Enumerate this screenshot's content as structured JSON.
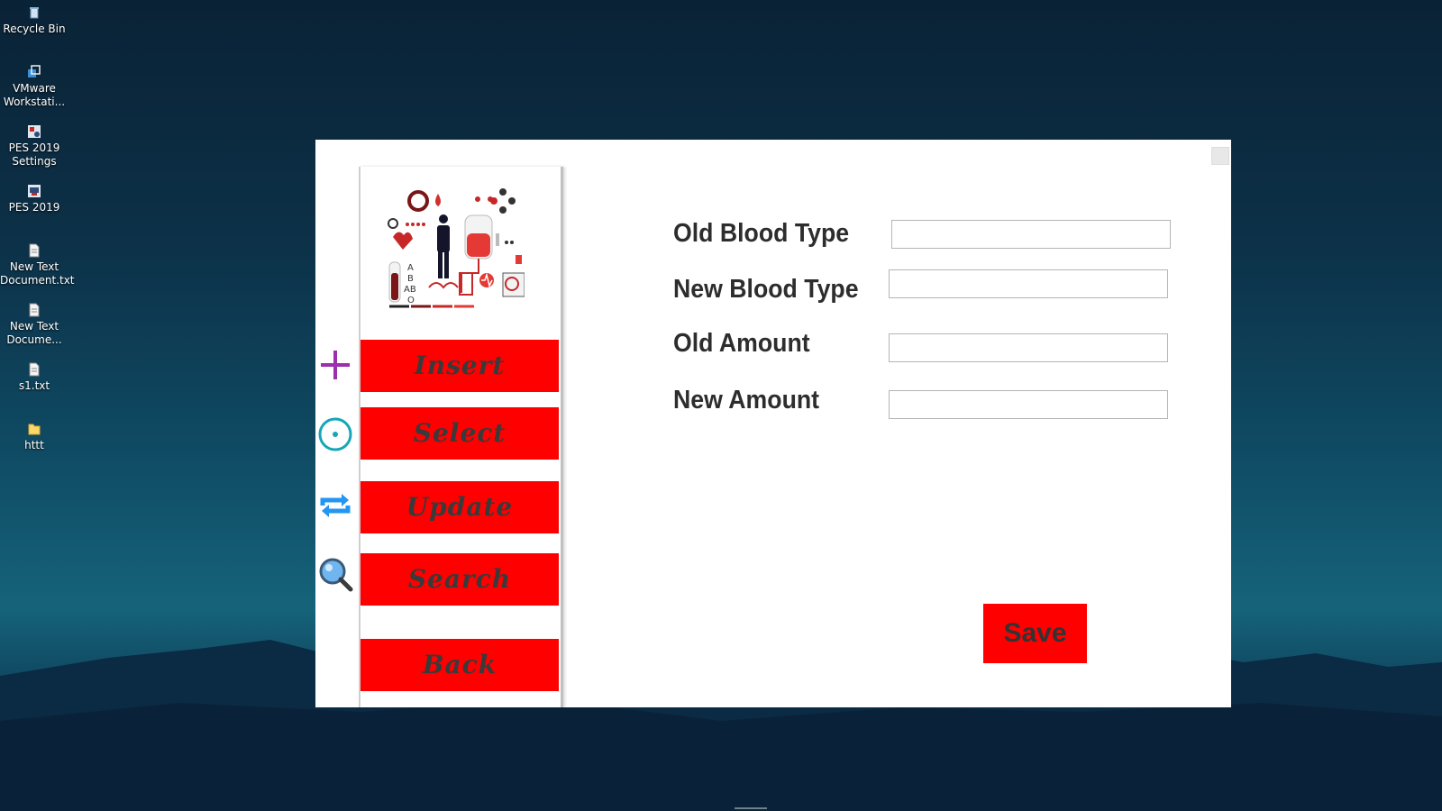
{
  "desktop": {
    "icons": [
      {
        "label": "Recycle Bin",
        "icon": "recycle-bin-icon"
      },
      {
        "label": "VMware Workstati...",
        "icon": "vmware-icon"
      },
      {
        "label": "PES 2019 Settings",
        "icon": "pes-settings-icon"
      },
      {
        "label": "PES 2019",
        "icon": "pes-icon"
      },
      {
        "label": "New Text Document.txt",
        "icon": "text-file-icon"
      },
      {
        "label": "New Text Docume...",
        "icon": "text-file-icon"
      },
      {
        "label": "s1.txt",
        "icon": "text-file-icon"
      },
      {
        "label": "httt",
        "icon": "folder-icon"
      }
    ]
  },
  "sidebar": {
    "buttons": [
      {
        "label": "Insert",
        "icon": "plus-icon"
      },
      {
        "label": "Select",
        "icon": "target-icon"
      },
      {
        "label": "Update",
        "icon": "repeat-icon"
      },
      {
        "label": "Search",
        "icon": "magnifier-icon"
      },
      {
        "label": "Back"
      }
    ],
    "logo_letters": [
      "A",
      "B",
      "AB",
      "O"
    ]
  },
  "form": {
    "old_blood_type": {
      "label": "Old Blood Type",
      "value": ""
    },
    "new_blood_type": {
      "label": "New Blood Type",
      "value": ""
    },
    "old_amount": {
      "label": "Old Amount",
      "value": ""
    },
    "new_amount": {
      "label": "New Amount",
      "value": ""
    },
    "save_label": "Save"
  },
  "colors": {
    "accent": "#ff0000",
    "button_text": "#3a3a3a",
    "plus_icon": "#9b2fae",
    "target_icon": "#16a6b6",
    "repeat_icon": "#2196f3"
  }
}
